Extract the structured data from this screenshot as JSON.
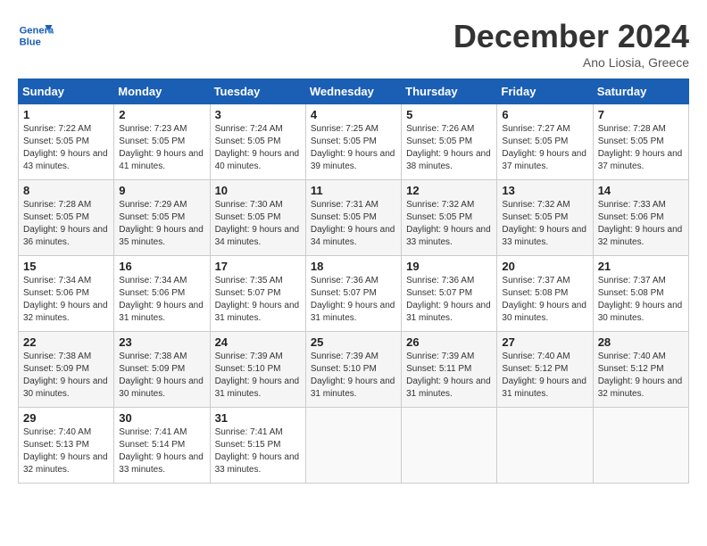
{
  "header": {
    "logo_line1": "General",
    "logo_line2": "Blue",
    "month_title": "December 2024",
    "location": "Ano Liosia, Greece"
  },
  "weekdays": [
    "Sunday",
    "Monday",
    "Tuesday",
    "Wednesday",
    "Thursday",
    "Friday",
    "Saturday"
  ],
  "weeks": [
    [
      {
        "day": "1",
        "sunrise": "7:22 AM",
        "sunset": "5:05 PM",
        "daylight": "9 hours and 43 minutes."
      },
      {
        "day": "2",
        "sunrise": "7:23 AM",
        "sunset": "5:05 PM",
        "daylight": "9 hours and 41 minutes."
      },
      {
        "day": "3",
        "sunrise": "7:24 AM",
        "sunset": "5:05 PM",
        "daylight": "9 hours and 40 minutes."
      },
      {
        "day": "4",
        "sunrise": "7:25 AM",
        "sunset": "5:05 PM",
        "daylight": "9 hours and 39 minutes."
      },
      {
        "day": "5",
        "sunrise": "7:26 AM",
        "sunset": "5:05 PM",
        "daylight": "9 hours and 38 minutes."
      },
      {
        "day": "6",
        "sunrise": "7:27 AM",
        "sunset": "5:05 PM",
        "daylight": "9 hours and 37 minutes."
      },
      {
        "day": "7",
        "sunrise": "7:28 AM",
        "sunset": "5:05 PM",
        "daylight": "9 hours and 37 minutes."
      }
    ],
    [
      {
        "day": "8",
        "sunrise": "7:28 AM",
        "sunset": "5:05 PM",
        "daylight": "9 hours and 36 minutes."
      },
      {
        "day": "9",
        "sunrise": "7:29 AM",
        "sunset": "5:05 PM",
        "daylight": "9 hours and 35 minutes."
      },
      {
        "day": "10",
        "sunrise": "7:30 AM",
        "sunset": "5:05 PM",
        "daylight": "9 hours and 34 minutes."
      },
      {
        "day": "11",
        "sunrise": "7:31 AM",
        "sunset": "5:05 PM",
        "daylight": "9 hours and 34 minutes."
      },
      {
        "day": "12",
        "sunrise": "7:32 AM",
        "sunset": "5:05 PM",
        "daylight": "9 hours and 33 minutes."
      },
      {
        "day": "13",
        "sunrise": "7:32 AM",
        "sunset": "5:05 PM",
        "daylight": "9 hours and 33 minutes."
      },
      {
        "day": "14",
        "sunrise": "7:33 AM",
        "sunset": "5:06 PM",
        "daylight": "9 hours and 32 minutes."
      }
    ],
    [
      {
        "day": "15",
        "sunrise": "7:34 AM",
        "sunset": "5:06 PM",
        "daylight": "9 hours and 32 minutes."
      },
      {
        "day": "16",
        "sunrise": "7:34 AM",
        "sunset": "5:06 PM",
        "daylight": "9 hours and 31 minutes."
      },
      {
        "day": "17",
        "sunrise": "7:35 AM",
        "sunset": "5:07 PM",
        "daylight": "9 hours and 31 minutes."
      },
      {
        "day": "18",
        "sunrise": "7:36 AM",
        "sunset": "5:07 PM",
        "daylight": "9 hours and 31 minutes."
      },
      {
        "day": "19",
        "sunrise": "7:36 AM",
        "sunset": "5:07 PM",
        "daylight": "9 hours and 31 minutes."
      },
      {
        "day": "20",
        "sunrise": "7:37 AM",
        "sunset": "5:08 PM",
        "daylight": "9 hours and 30 minutes."
      },
      {
        "day": "21",
        "sunrise": "7:37 AM",
        "sunset": "5:08 PM",
        "daylight": "9 hours and 30 minutes."
      }
    ],
    [
      {
        "day": "22",
        "sunrise": "7:38 AM",
        "sunset": "5:09 PM",
        "daylight": "9 hours and 30 minutes."
      },
      {
        "day": "23",
        "sunrise": "7:38 AM",
        "sunset": "5:09 PM",
        "daylight": "9 hours and 30 minutes."
      },
      {
        "day": "24",
        "sunrise": "7:39 AM",
        "sunset": "5:10 PM",
        "daylight": "9 hours and 31 minutes."
      },
      {
        "day": "25",
        "sunrise": "7:39 AM",
        "sunset": "5:10 PM",
        "daylight": "9 hours and 31 minutes."
      },
      {
        "day": "26",
        "sunrise": "7:39 AM",
        "sunset": "5:11 PM",
        "daylight": "9 hours and 31 minutes."
      },
      {
        "day": "27",
        "sunrise": "7:40 AM",
        "sunset": "5:12 PM",
        "daylight": "9 hours and 31 minutes."
      },
      {
        "day": "28",
        "sunrise": "7:40 AM",
        "sunset": "5:12 PM",
        "daylight": "9 hours and 32 minutes."
      }
    ],
    [
      {
        "day": "29",
        "sunrise": "7:40 AM",
        "sunset": "5:13 PM",
        "daylight": "9 hours and 32 minutes."
      },
      {
        "day": "30",
        "sunrise": "7:41 AM",
        "sunset": "5:14 PM",
        "daylight": "9 hours and 33 minutes."
      },
      {
        "day": "31",
        "sunrise": "7:41 AM",
        "sunset": "5:15 PM",
        "daylight": "9 hours and 33 minutes."
      },
      null,
      null,
      null,
      null
    ]
  ],
  "labels": {
    "sunrise": "Sunrise:",
    "sunset": "Sunset:",
    "daylight": "Daylight:"
  }
}
